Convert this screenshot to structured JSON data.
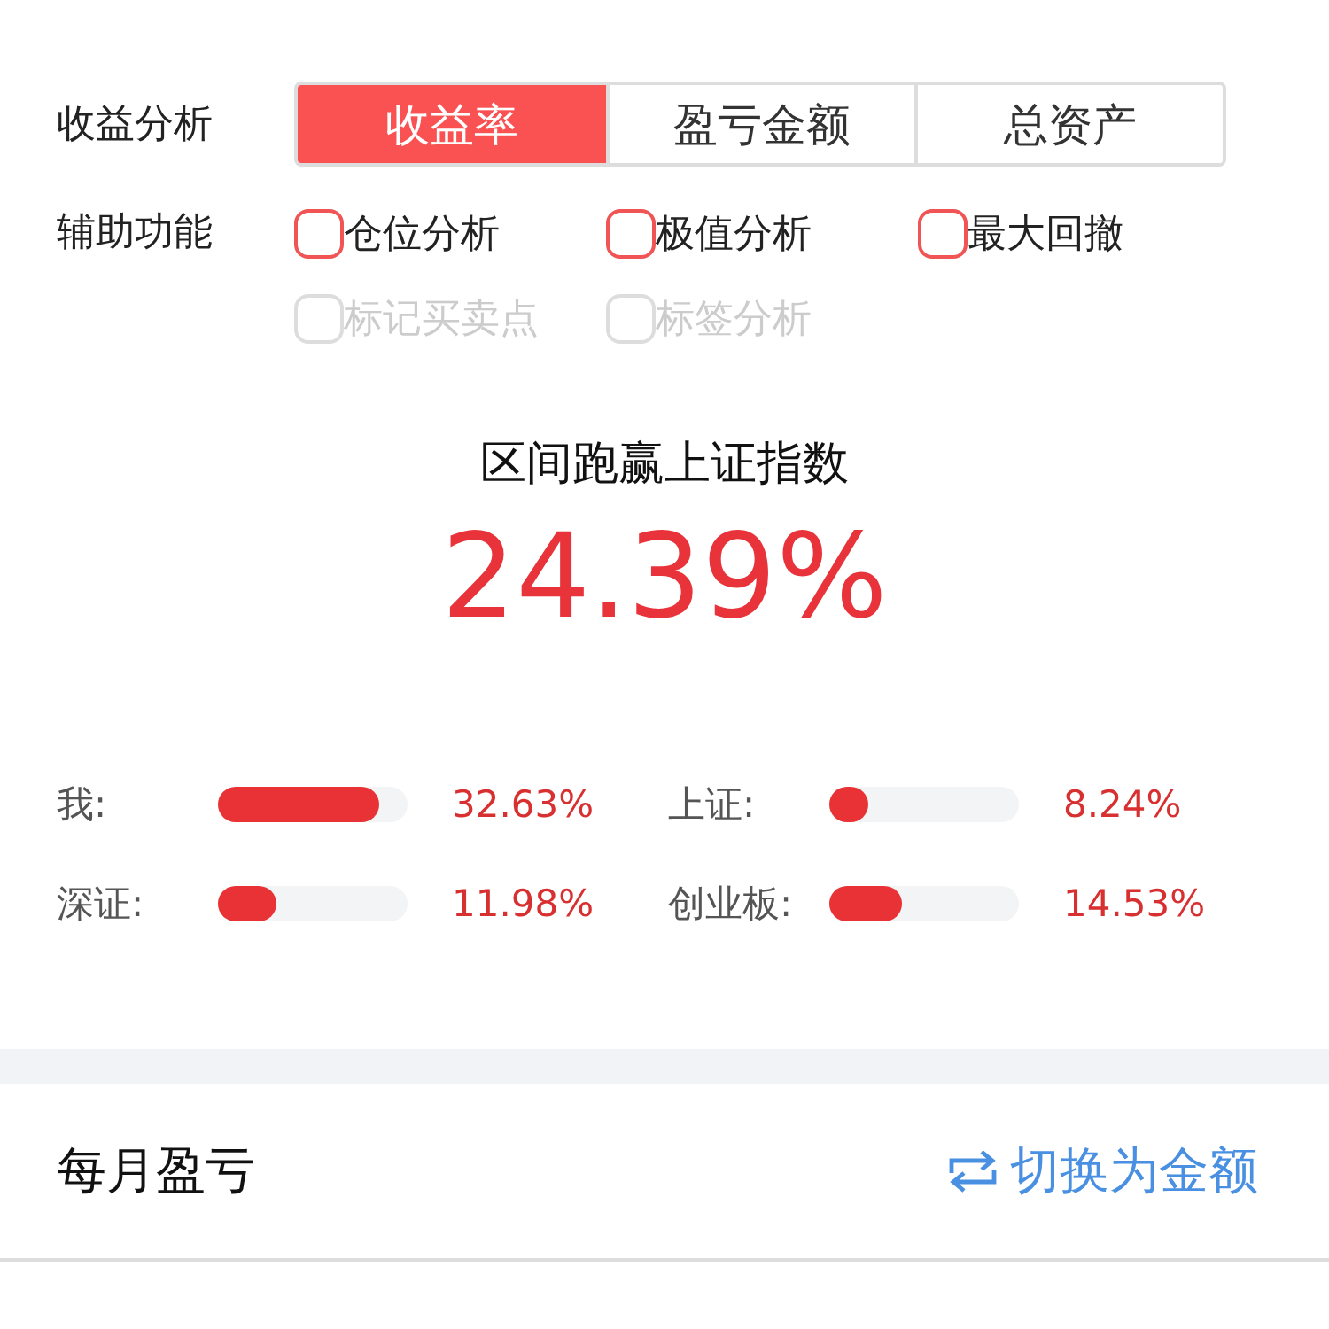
{
  "analysis": {
    "label": "收益分析",
    "tabs": [
      {
        "label": "收益率",
        "selected": true
      },
      {
        "label": "盈亏金额",
        "selected": false
      },
      {
        "label": "总资产",
        "selected": false
      }
    ]
  },
  "auxiliary": {
    "label": "辅助功能",
    "options": [
      {
        "label": "仓位分析",
        "checked": false,
        "disabled": false
      },
      {
        "label": "极值分析",
        "checked": false,
        "disabled": false
      },
      {
        "label": "最大回撤",
        "checked": false,
        "disabled": false
      },
      {
        "label": "标记买卖点",
        "checked": false,
        "disabled": true
      },
      {
        "label": "标签分析",
        "checked": false,
        "disabled": true
      }
    ]
  },
  "summary": {
    "title": "区间跑赢上证指数",
    "value": "24.39%"
  },
  "comparisons": [
    {
      "name": "我:",
      "level": 0.85,
      "reading": "32.63%"
    },
    {
      "name": "上证:",
      "level": 0.21,
      "reading": "8.24%"
    },
    {
      "name": "深证:",
      "level": 0.31,
      "reading": "11.98%"
    },
    {
      "name": "创业板:",
      "level": 0.38,
      "reading": "14.53%"
    }
  ],
  "monthly": {
    "title": "每月盈亏",
    "switch_link": "切换为金额"
  }
}
